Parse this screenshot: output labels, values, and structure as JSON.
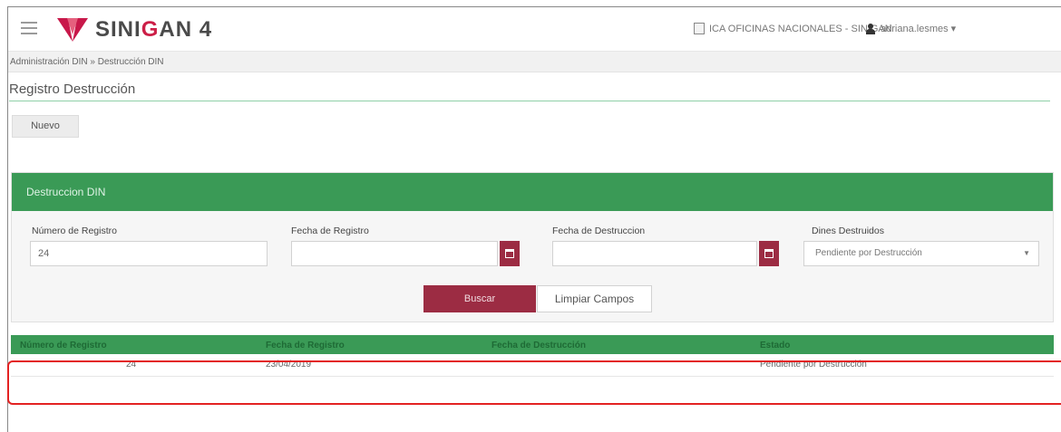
{
  "header": {
    "brand_prefix": "SINI",
    "brand_highlight": "G",
    "brand_suffix": "AN 4",
    "organization": "ICA OFICINAS NACIONALES - SINIGAN",
    "user": "adriana.lesmes ▾"
  },
  "breadcrumb": {
    "parent": "Administración DIN",
    "separator": "»",
    "current": "Destrucción DIN"
  },
  "page": {
    "title": "Registro Destrucción",
    "new_button": "Nuevo"
  },
  "filter_panel": {
    "title": "Destruccion DIN",
    "fields": {
      "registro_label": "Número de Registro",
      "registro_value": "24",
      "fecha_registro_label": "Fecha de Registro",
      "fecha_registro_value": "",
      "fecha_destruccion_label": "Fecha de Destruccion",
      "fecha_destruccion_value": "",
      "dines_label": "Dines Destruidos",
      "dines_value": "Pendiente por Destrucción"
    },
    "search_button": "Buscar",
    "clear_button": "Limpiar Campos"
  },
  "results": {
    "columns": [
      "Número de Registro",
      "Fecha de Registro",
      "Fecha de Destrucción",
      "Estado"
    ],
    "rows": [
      [
        "24",
        "23/04/2019",
        "",
        "Pendiente por Destrucción"
      ]
    ]
  },
  "colors": {
    "accent_green": "#3a9a56",
    "accent_maroon": "#9c2c43",
    "highlight_red": "#e32222"
  },
  "icons": [
    "menu-icon",
    "sinigan-logo-icon",
    "building-icon",
    "user-icon",
    "calendar-icon",
    "chevron-down-icon"
  ]
}
